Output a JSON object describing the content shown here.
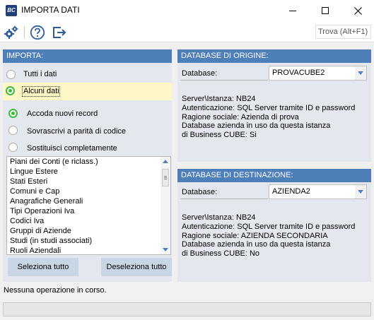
{
  "window": {
    "title": "IMPORTA DATI",
    "app_icon_text": "BC"
  },
  "toolbar": {
    "settings_icon": "gears-icon",
    "help_icon": "help-circle-icon",
    "exit_icon": "exit-icon",
    "search_placeholder": "Trova (Alt+F1)"
  },
  "import": {
    "header": "IMPORTA:",
    "scope_options": [
      {
        "label": "Tutti i dati",
        "selected": false
      },
      {
        "label": "Alcuni dati",
        "selected": true
      }
    ],
    "mode_options": [
      {
        "label": "Accoda nuovi record",
        "selected": true
      },
      {
        "label": "Sovrascrivi a parità di codice",
        "selected": false
      },
      {
        "label": "Sostituisci completamente",
        "selected": false
      }
    ],
    "tables": [
      "Piani dei Conti (e riclass.)",
      "Lingue Estere",
      "Stati Esteri",
      "Comuni e Cap",
      "Anagrafiche Generali",
      "Tipi Operazioni Iva",
      "Codici Iva",
      "Gruppi di Aziende",
      "Studi (in studi associati)",
      "Ruoli Aziendali"
    ],
    "select_all_label": "Seleziona tutto",
    "deselect_all_label": "Deseleziona tutto"
  },
  "source": {
    "header": "DATABASE DI ORIGINE:",
    "database_label": "Database:",
    "database_value": "PROVACUBE2",
    "server_line": "Server\\Istanza: NB24",
    "auth_line": "Autenticazione: SQL Server tramite ID e password",
    "company_line": "Ragione sociale: Azienda di prova",
    "in_use_line1": "Database azienda in uso da questa istanza",
    "in_use_line2": "di Business CUBE: Si"
  },
  "destination": {
    "header": "DATABASE DI DESTINAZIONE:",
    "database_label": "Database:",
    "database_value": "AZIENDA2",
    "server_line": "Server\\Istanza: NB24",
    "auth_line": "Autenticazione: SQL Server tramite ID e password",
    "company_line": "Ragione sociale: AZIENDA SECONDARIA",
    "in_use_line1": "Database azienda in uso da questa istanza",
    "in_use_line2": "di Business CUBE: No"
  },
  "status": {
    "text": "Nessuna operazione in corso.",
    "progress": 0
  },
  "colors": {
    "panel_header": "#4f7fb8",
    "panel_body": "#e4e8ee",
    "selected_radio": "#3cbc3c",
    "highlight": "#fff8c6",
    "button": "#c9d6e6"
  }
}
